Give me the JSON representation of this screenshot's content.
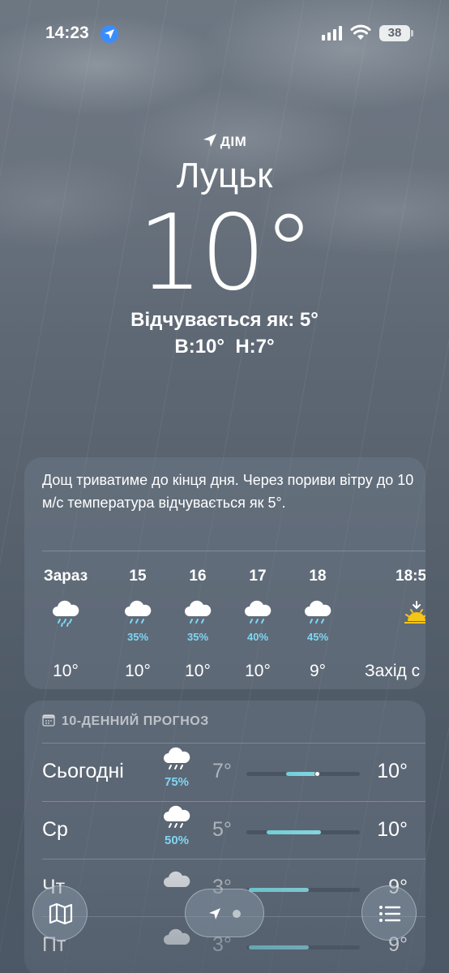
{
  "status_bar": {
    "time": "14:23",
    "battery": "38"
  },
  "hero": {
    "home_label": "ДІМ",
    "city": "Луцьк",
    "temperature": "10°",
    "feels_like": "Відчувається як: 5°",
    "hi_lo": "В:10°  Н:7°"
  },
  "hourly": {
    "summary": "Дощ триватиме до кінця дня. Через пориви вітру до 10 м/с температура відчувається як 5°.",
    "items": [
      {
        "label": "Зараз",
        "icon": "rain-cloud-icon",
        "pop": "",
        "temp": "10°"
      },
      {
        "label": "15",
        "icon": "rain-cloud-icon",
        "pop": "35%",
        "temp": "10°"
      },
      {
        "label": "16",
        "icon": "rain-cloud-icon",
        "pop": "35%",
        "temp": "10°"
      },
      {
        "label": "17",
        "icon": "rain-cloud-icon",
        "pop": "40%",
        "temp": "10°"
      },
      {
        "label": "18",
        "icon": "rain-cloud-icon",
        "pop": "45%",
        "temp": "9°"
      },
      {
        "label": "18:5",
        "icon": "sunset-icon",
        "pop": "",
        "temp": "Захід с"
      }
    ]
  },
  "daily": {
    "header": "10-ДЕННИЙ ПРОГНОЗ",
    "days": [
      {
        "name": "Сьогодні",
        "icon": "rain-cloud-icon",
        "pop": "75%",
        "low": "7°",
        "high": "10°",
        "range_start": 0.35,
        "range_end": 0.62,
        "current": 0.62
      },
      {
        "name": "Ср",
        "icon": "rain-cloud-icon",
        "pop": "50%",
        "low": "5°",
        "high": "10°",
        "range_start": 0.18,
        "range_end": 0.66
      },
      {
        "name": "Чт",
        "icon": "cloud-icon",
        "pop": "",
        "low": "3°",
        "high": "9°",
        "range_start": 0.02,
        "range_end": 0.55
      },
      {
        "name": "Пт",
        "icon": "cloud-icon",
        "pop": "",
        "low": "3°",
        "high": "9°",
        "range_start": 0.02,
        "range_end": 0.55
      }
    ]
  },
  "colors": {
    "accent_blue": "#3a8dff",
    "precip_cyan": "#7fd6f2",
    "range_bar": "#6fd0d6",
    "sun_yellow": "#f5c518"
  }
}
